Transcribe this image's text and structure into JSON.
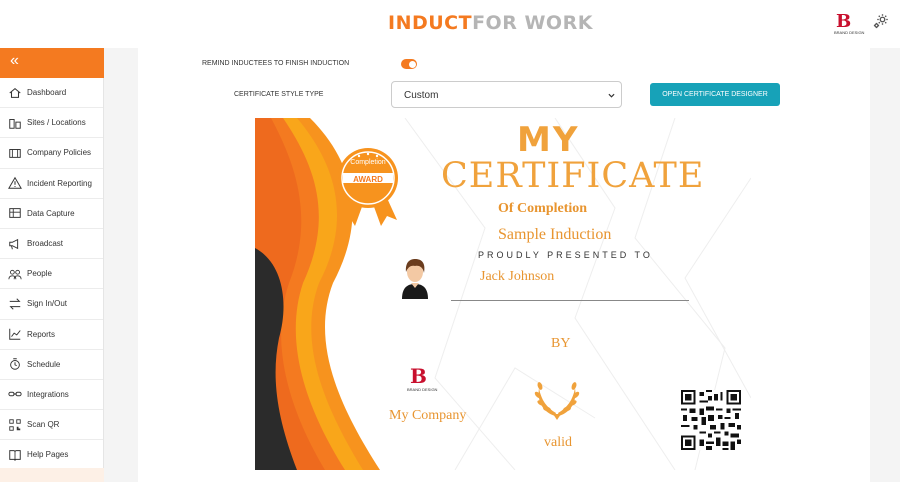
{
  "header": {
    "logo_part1": "INDUCT",
    "logo_part2": "FOR WORK",
    "brand_letter": "B",
    "brand_caption": "BRAND DESIGN",
    "settings_icon": "gear-icon"
  },
  "sidebar": {
    "collapse_glyph": "«",
    "items": [
      {
        "label": "Dashboard",
        "icon": "home-icon"
      },
      {
        "label": "Sites / Locations",
        "icon": "sites-icon"
      },
      {
        "label": "Company Policies",
        "icon": "policies-icon"
      },
      {
        "label": "Incident Reporting",
        "icon": "warning-icon"
      },
      {
        "label": "Data Capture",
        "icon": "data-capture-icon"
      },
      {
        "label": "Broadcast",
        "icon": "megaphone-icon"
      },
      {
        "label": "People",
        "icon": "people-icon"
      },
      {
        "label": "Sign In/Out",
        "icon": "sign-in-out-icon"
      },
      {
        "label": "Reports",
        "icon": "reports-icon"
      },
      {
        "label": "Schedule",
        "icon": "schedule-icon"
      },
      {
        "label": "Integrations",
        "icon": "integrations-icon"
      },
      {
        "label": "Scan QR",
        "icon": "qr-icon"
      },
      {
        "label": "Help Pages",
        "icon": "book-icon"
      }
    ]
  },
  "settings": {
    "remind_label": "REMIND INDUCTEES TO FINISH INDUCTION",
    "remind_enabled": true,
    "style_label": "CERTIFICATE STYLE TYPE",
    "style_value": "Custom",
    "designer_button": "OPEN CERTIFICATE DESIGNER"
  },
  "certificate": {
    "title_top": "MY",
    "title_main": "CERTIFICATE",
    "subtitle": "Of Completion",
    "induction_name": "Sample Induction",
    "presented_to": "PROUDLY PRESENTED TO",
    "recipient": "Jack Johnson",
    "by": "BY",
    "company": "My Company",
    "valid": "valid",
    "badge_line1": "Completion",
    "badge_line2": "AWARD",
    "company_logo_letter": "B",
    "company_logo_caption": "BRAND DESIGN",
    "colors": {
      "orange": "#f47a20",
      "gold": "#f0a23c",
      "yellow": "#f9a61a",
      "dark": "#2b2b2b"
    }
  }
}
